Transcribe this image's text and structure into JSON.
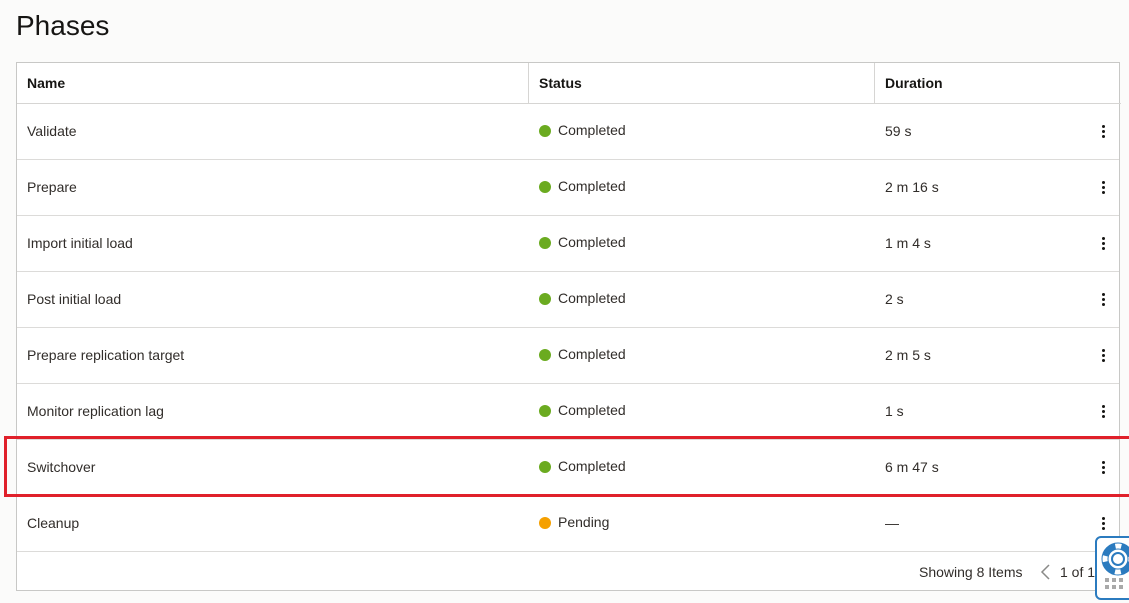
{
  "page": {
    "title": "Phases"
  },
  "table": {
    "columns": {
      "name": "Name",
      "status": "Status",
      "duration": "Duration"
    },
    "rows": [
      {
        "name": "Validate",
        "status": "Completed",
        "status_color": "#6bab20",
        "duration": "59 s"
      },
      {
        "name": "Prepare",
        "status": "Completed",
        "status_color": "#6bab20",
        "duration": "2 m 16 s"
      },
      {
        "name": "Import initial load",
        "status": "Completed",
        "status_color": "#6bab20",
        "duration": "1 m 4 s"
      },
      {
        "name": "Post initial load",
        "status": "Completed",
        "status_color": "#6bab20",
        "duration": "2 s"
      },
      {
        "name": "Prepare replication target",
        "status": "Completed",
        "status_color": "#6bab20",
        "duration": "2 m 5 s"
      },
      {
        "name": "Monitor replication lag",
        "status": "Completed",
        "status_color": "#6bab20",
        "duration": "1 s"
      },
      {
        "name": "Switchover",
        "status": "Completed",
        "status_color": "#6bab20",
        "duration": "6 m 47 s"
      },
      {
        "name": "Cleanup",
        "status": "Pending",
        "status_color": "#f5a000",
        "duration": "—"
      }
    ]
  },
  "footer": {
    "count_text": "Showing 8 Items",
    "page_text": "1 of 1"
  },
  "icons": {
    "row_actions": "kebab-menu-icon",
    "prev": "chevron-left-icon",
    "help": "lifebuoy-icon"
  },
  "colors": {
    "highlight": "#e0202a",
    "completed": "#6bab20",
    "pending": "#f5a000",
    "help_border": "#2b7bbf"
  }
}
